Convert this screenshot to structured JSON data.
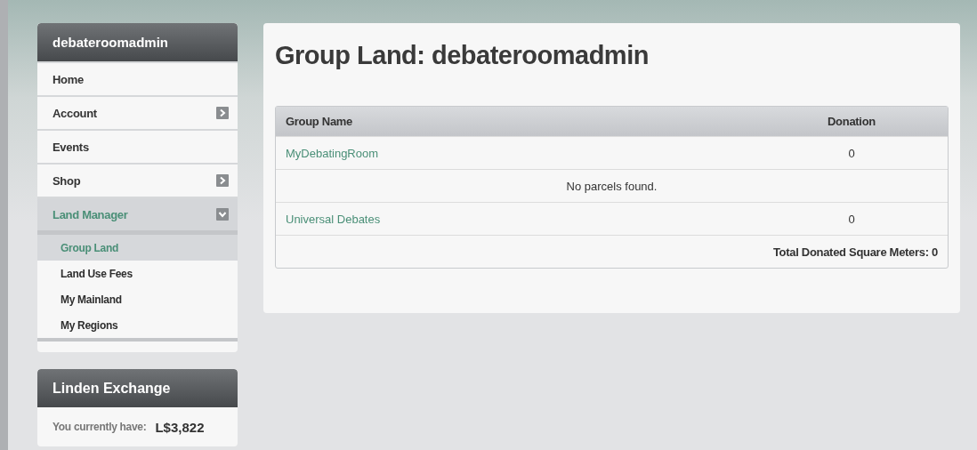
{
  "sidebar": {
    "title": "debateroomadmin",
    "items": [
      {
        "label": "Home",
        "selected": false
      },
      {
        "label": "Account",
        "selected": false,
        "expanded": false
      },
      {
        "label": "Events",
        "selected": false
      },
      {
        "label": "Shop",
        "selected": false,
        "expanded": false
      },
      {
        "label": "Land Manager",
        "selected": true,
        "expanded": true,
        "children": [
          {
            "label": "Group Land",
            "selected": true
          },
          {
            "label": "Land Use Fees",
            "selected": false
          },
          {
            "label": "My Mainland",
            "selected": false
          },
          {
            "label": "My Regions",
            "selected": false
          }
        ]
      }
    ]
  },
  "exchange": {
    "title": "Linden Exchange",
    "label": "You currently have:",
    "balance": "L$3,822"
  },
  "main": {
    "title": "Group Land: debateroomadmin",
    "table": {
      "columns": [
        "Group Name",
        "Donation"
      ],
      "rows": [
        {
          "kind": "group",
          "name": "MyDebatingRoom",
          "donation": "0"
        },
        {
          "kind": "message",
          "text": "No parcels found."
        },
        {
          "kind": "group",
          "name": "Universal Debates",
          "donation": "0"
        },
        {
          "kind": "total",
          "text": "Total Donated Square Meters: 0"
        }
      ]
    }
  }
}
